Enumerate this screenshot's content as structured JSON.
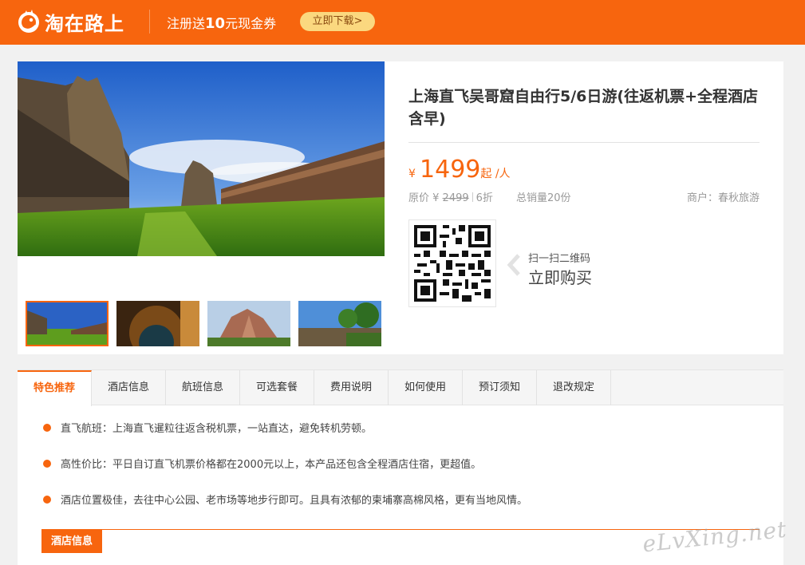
{
  "header": {
    "brand": "淘在路上",
    "promo_prefix": "注册送",
    "promo_amount": "10",
    "promo_suffix": "元现金券",
    "download_label": "立即下载>"
  },
  "product": {
    "title": "上海直飞吴哥窟自由行5/6日游(往返机票+全程酒店含早)",
    "currency": "¥",
    "price": "1499",
    "price_unit": "起 /人",
    "original_label": "原价 ¥ ",
    "original_price": "2499",
    "discount": "6折",
    "sales": "总销量20份",
    "merchant": "商户：春秋旅游",
    "scan_hint": "扫一扫二维码",
    "buy_now": "立即购买"
  },
  "tabs": [
    {
      "label": "特色推荐"
    },
    {
      "label": "酒店信息"
    },
    {
      "label": "航班信息"
    },
    {
      "label": "可选套餐"
    },
    {
      "label": "费用说明"
    },
    {
      "label": "如何使用"
    },
    {
      "label": "预订须知"
    },
    {
      "label": "退改规定"
    }
  ],
  "features": [
    "直飞航班：上海直飞暹粒往返含税机票，一站直达，避免转机劳顿。",
    "高性价比：平日自订直飞机票价格都在2000元以上，本产品还包含全程酒店住宿，更超值。",
    "酒店位置极佳，去往中心公园、老市场等地步行即可。且具有浓郁的柬埔寨高棉风格，更有当地风情。"
  ],
  "section_tag": "酒店信息",
  "watermark": "eLvXing.net",
  "colors": {
    "accent": "#f7650e",
    "promo_button": "#fbd87f"
  }
}
